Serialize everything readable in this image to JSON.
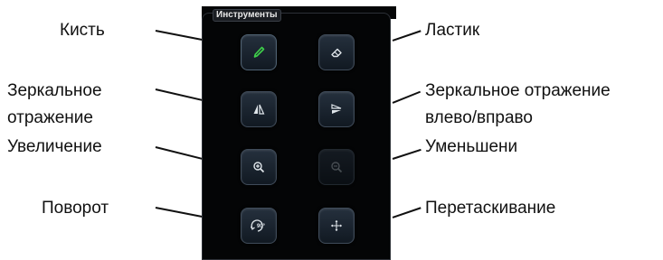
{
  "panel": {
    "title": "Инструменты"
  },
  "labels": {
    "brush": "Кисть",
    "eraser": "Ластик",
    "mirror_updown": "Зеркальное\nотражение",
    "mirror_leftright": "Зеркальное отражение\nвлево/вправо",
    "zoom_in": "Увеличение",
    "zoom_out": "Уменьшени",
    "rotate": "Поворот",
    "drag": "Перетаскивание"
  },
  "tools": [
    {
      "id": "brush",
      "icon": "brush-icon",
      "state": "active"
    },
    {
      "id": "eraser",
      "icon": "eraser-icon",
      "state": "normal"
    },
    {
      "id": "mirror_updown",
      "icon": "mirror-vertical-icon",
      "state": "normal"
    },
    {
      "id": "mirror_leftright",
      "icon": "mirror-horizontal-icon",
      "state": "normal"
    },
    {
      "id": "zoom_in",
      "icon": "zoom-in-icon",
      "state": "normal"
    },
    {
      "id": "zoom_out",
      "icon": "zoom-out-icon",
      "state": "disabled"
    },
    {
      "id": "rotate",
      "icon": "rotate-90-icon",
      "state": "normal",
      "icon_text": "90°"
    },
    {
      "id": "drag",
      "icon": "move-icon",
      "state": "normal"
    }
  ],
  "colors": {
    "panel_bg": "#040506",
    "button_bg": "#1b2430",
    "brush_accent": "#3ed14a",
    "icon": "#dfe5ea"
  }
}
